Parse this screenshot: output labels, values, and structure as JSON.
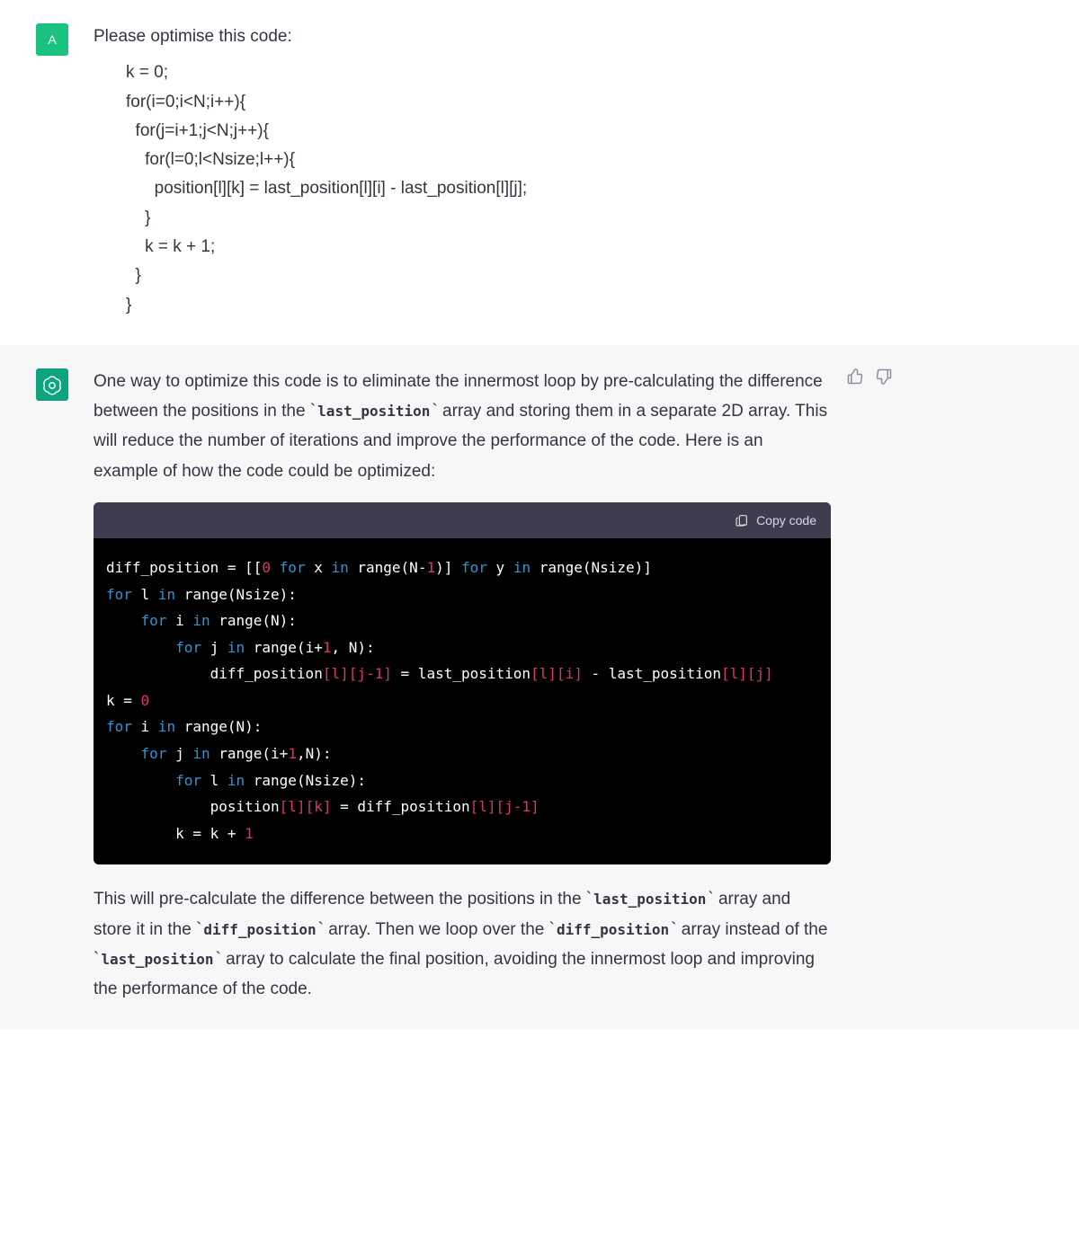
{
  "user": {
    "avatar_text": "A",
    "intro": "Please optimise this code:",
    "code_lines": [
      "k = 0;",
      "for(i=0;i<N;i++){",
      "  for(j=i+1;j<N;j++){",
      "    for(l=0;l<Nsize;l++){",
      "      position[l][k] = last_position[l][i] - last_position[l][j];",
      "    }",
      "    k = k + 1;",
      "  }",
      "}"
    ]
  },
  "assistant": {
    "para1_pre": "One way to optimize this code is to eliminate the innermost loop by pre-calculating the difference between the positions in the ",
    "para1_code1": "last_position",
    "para1_post": " array and storing them in a separate 2D array. This will reduce the number of iterations and improve the performance of the code. Here is an example of how the code could be optimized:",
    "copy_label": "Copy code",
    "code": {
      "l1_a": "diff_position = [[",
      "l1_zero": "0",
      "l1_b": " ",
      "l1_for1": "for",
      "l1_c": " x ",
      "l1_in1": "in",
      "l1_d": " range(N-",
      "l1_one": "1",
      "l1_e": ")]",
      "l1_f": " ",
      "l1_for2": "for",
      "l1_g": " y ",
      "l1_in2": "in",
      "l1_h": " range(Nsize)]",
      "l2_for": "for",
      "l2_rest": " l ",
      "l2_in": "in",
      "l2_r": " range(Nsize):",
      "l3_for": "for",
      "l3_rest": " i ",
      "l3_in": "in",
      "l3_r": " range(N):",
      "l4_for": "for",
      "l4_rest": " j ",
      "l4_in": "in",
      "l4_r": " range(i+",
      "l4_one": "1",
      "l4_r2": ", N):",
      "l5_a": "diff_position",
      "l5_b1": "[l]",
      "l5_b2": "[j-1]",
      "l5_eq": " = last_position",
      "l5_c1": "[l]",
      "l5_c2": "[i]",
      "l5_minus": " - last_position",
      "l5_d1": "[l]",
      "l5_d2": "[j]",
      "l6_a": "k = ",
      "l6_zero": "0",
      "l7_for": "for",
      "l7_rest": " i ",
      "l7_in": "in",
      "l7_r": " range(N):",
      "l8_for": "for",
      "l8_rest": " j ",
      "l8_in": "in",
      "l8_r": " range(i+",
      "l8_one": "1",
      "l8_r2": ",N):",
      "l9_for": "for",
      "l9_rest": " l ",
      "l9_in": "in",
      "l9_r": " range(Nsize):",
      "l10_a": "position",
      "l10_b1": "[l]",
      "l10_b2": "[k]",
      "l10_eq": " = diff_position",
      "l10_c1": "[l]",
      "l10_c2": "[j-1]",
      "l11_a": "k = k + ",
      "l11_one": "1"
    },
    "para2_pre": "This will pre-calculate the difference between the positions in the ",
    "para2_c1": "last_position",
    "para2_mid1": " array and store it in the ",
    "para2_c2": "diff_position",
    "para2_mid2": " array. Then we loop over the ",
    "para2_c3": "diff_position",
    "para2_mid3": " array instead of the ",
    "para2_c4": "last_position",
    "para2_post": " array to calculate the final position, avoiding the innermost loop and improving the performance of the code."
  }
}
